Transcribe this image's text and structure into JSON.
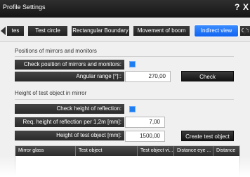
{
  "window": {
    "title": "Profile Settings",
    "help_label": "?",
    "close_label": "X"
  },
  "tabs": [
    {
      "label": "tes"
    },
    {
      "label": "Test circle"
    },
    {
      "label": "Rectangular Boundary"
    },
    {
      "label": "Movement of boom"
    },
    {
      "label": "Indirect view",
      "active": true
    },
    {
      "label": "Ch"
    }
  ],
  "section1": {
    "title": "Positions of mirrors and monitors",
    "check_position_label": "Check position of mirrors and monitors:",
    "check_position_checked": true,
    "angular_range_label": "Angular range [°]::",
    "angular_range_value": "270,00",
    "check_button": "Check"
  },
  "section2": {
    "title": "Height of test object in mirror",
    "check_height_label": "Check height of reflection:",
    "check_height_checked": true,
    "req_height_label": "Req. height of reflection per 1,2m [mm]:",
    "req_height_value": "7,00",
    "height_test_label": "Height of test object [mm]:",
    "height_test_value": "1500,00",
    "create_button": "Create test object"
  },
  "grid": {
    "columns": [
      "Mirror glass",
      "Test object",
      "Test object vi...",
      "Distance eye ...",
      "Distance"
    ]
  },
  "colors": {
    "accent": "#1e7df0",
    "dark": "#2a2a2a"
  }
}
